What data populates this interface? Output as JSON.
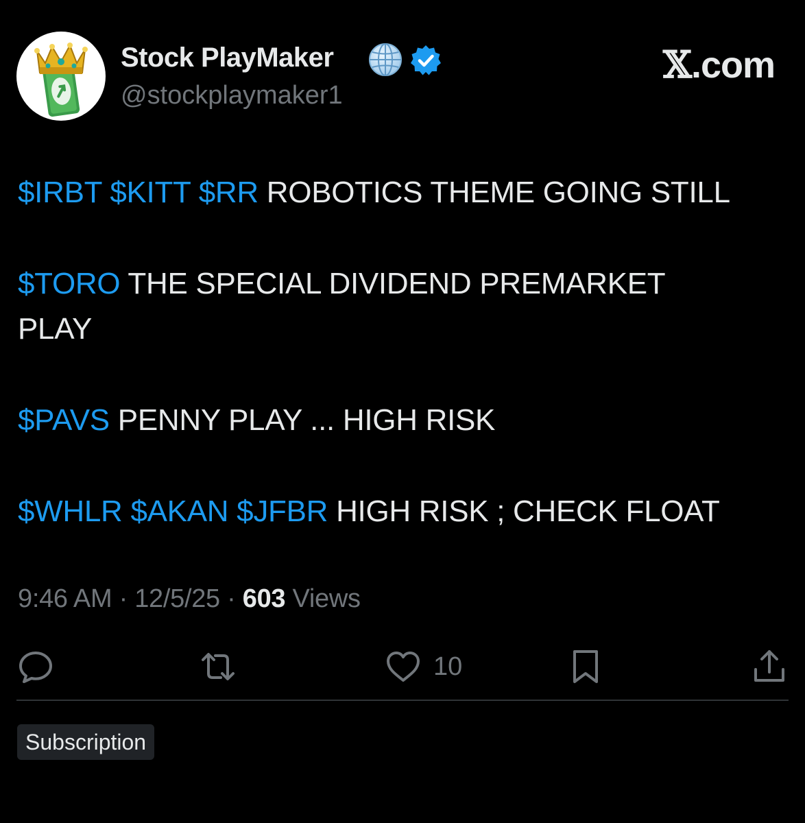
{
  "author": {
    "display_name": "Stock PlayMaker",
    "handle": "@stockplaymaker1",
    "avatar_icon": "crown-card-avatar",
    "badges": [
      "globe-icon",
      "verified-badge-icon"
    ]
  },
  "brand": {
    "prefix": "𝕏",
    "suffix": ".com"
  },
  "post": {
    "lines": [
      {
        "tags": "$IRBT $KITT $RR",
        "text": " ROBOTICS THEME GOING STILL"
      },
      {
        "tags": "$TORO",
        "text": " THE SPECIAL DIVIDEND PREMARKET"
      },
      {
        "tags": "",
        "text": "PLAY"
      },
      {
        "tags": "$PAVS",
        "text": " PENNY PLAY ... HIGH RISK"
      },
      {
        "tags": "$WHLR $AKAN $JFBR",
        "text": " HIGH RISK ; CHECK FLOAT"
      }
    ]
  },
  "meta": {
    "time": "9:46 AM",
    "sep1": " · ",
    "date": "12/5/25",
    "sep2": " · ",
    "views_count": "603",
    "views_label": " Views"
  },
  "actions": {
    "reply_icon": "speech-bubble-icon",
    "repost_icon": "repost-arrows-icon",
    "like_icon": "heart-icon",
    "like_count": "10",
    "bookmark_icon": "bookmark-icon",
    "share_icon": "share-icon"
  },
  "subscription_label": "Subscription",
  "colors": {
    "background": "#000000",
    "text": "#e7e9ea",
    "muted": "#71767b",
    "accent": "#1d9bf0",
    "divider": "#2f3336"
  }
}
